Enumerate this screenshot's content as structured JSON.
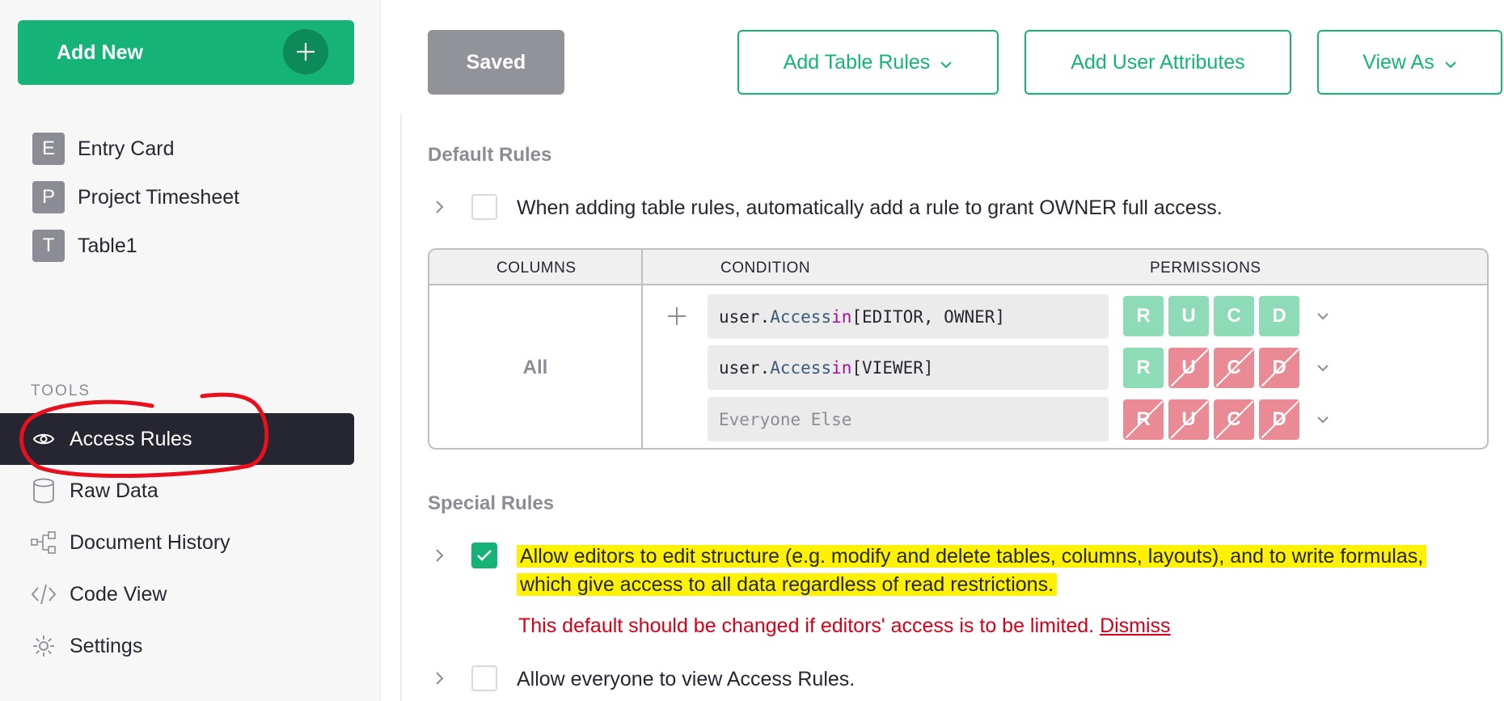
{
  "sidebar": {
    "add_new_label": "Add New",
    "pages": [
      {
        "badge": "E",
        "name": "Entry Card"
      },
      {
        "badge": "P",
        "name": "Project Timesheet"
      },
      {
        "badge": "T",
        "name": "Table1"
      }
    ],
    "tools_label": "TOOLS",
    "tools": [
      {
        "name": "Access Rules",
        "icon": "eye-icon",
        "active": true
      },
      {
        "name": "Raw Data",
        "icon": "database-icon"
      },
      {
        "name": "Document History",
        "icon": "history-icon"
      },
      {
        "name": "Code View",
        "icon": "code-icon"
      },
      {
        "name": "Settings",
        "icon": "gear-icon"
      }
    ]
  },
  "toolbar": {
    "saved_label": "Saved",
    "add_table_rules_label": "Add Table Rules",
    "add_user_attributes_label": "Add User Attributes",
    "view_as_label": "View As"
  },
  "default_rules": {
    "title": "Default Rules",
    "owner_rule_text": "When adding table rules, automatically add a rule to grant OWNER full access.",
    "owner_rule_checked": false,
    "table": {
      "headers": {
        "columns": "COLUMNS",
        "condition": "CONDITION",
        "permissions": "PERMISSIONS"
      },
      "columns_value": "All",
      "rows": [
        {
          "cond_var": "user",
          "cond_prop": "Access",
          "cond_kw": "in",
          "cond_list": "[EDITOR, OWNER]",
          "perms": [
            {
              "l": "R",
              "allow": true
            },
            {
              "l": "U",
              "allow": true
            },
            {
              "l": "C",
              "allow": true
            },
            {
              "l": "D",
              "allow": true
            }
          ]
        },
        {
          "cond_var": "user",
          "cond_prop": "Access",
          "cond_kw": "in",
          "cond_list": "[VIEWER]",
          "perms": [
            {
              "l": "R",
              "allow": true
            },
            {
              "l": "U",
              "allow": false
            },
            {
              "l": "C",
              "allow": false
            },
            {
              "l": "D",
              "allow": false
            }
          ]
        },
        {
          "placeholder": "Everyone Else",
          "perms": [
            {
              "l": "R",
              "allow": false
            },
            {
              "l": "U",
              "allow": false
            },
            {
              "l": "C",
              "allow": false
            },
            {
              "l": "D",
              "allow": false
            }
          ]
        }
      ]
    }
  },
  "special_rules": {
    "title": "Special Rules",
    "edit_structure_text_1": "Allow editors to edit structure (e.g. modify and delete tables, columns, layouts), and to write formulas,",
    "edit_structure_text_2": "which give access to all data regardless of read restrictions.",
    "edit_structure_checked": true,
    "warning_text": "This default should be changed if editors' access is to be limited.",
    "dismiss_label": "Dismiss",
    "view_rules_text": "Allow everyone to view Access Rules.",
    "view_rules_checked": false
  },
  "colors": {
    "accent": "#16b378",
    "allow": "#8edbb8",
    "deny": "#ea8a95",
    "warning": "#d0021b",
    "highlight": "#fff200",
    "annotation": "#e8101c"
  }
}
